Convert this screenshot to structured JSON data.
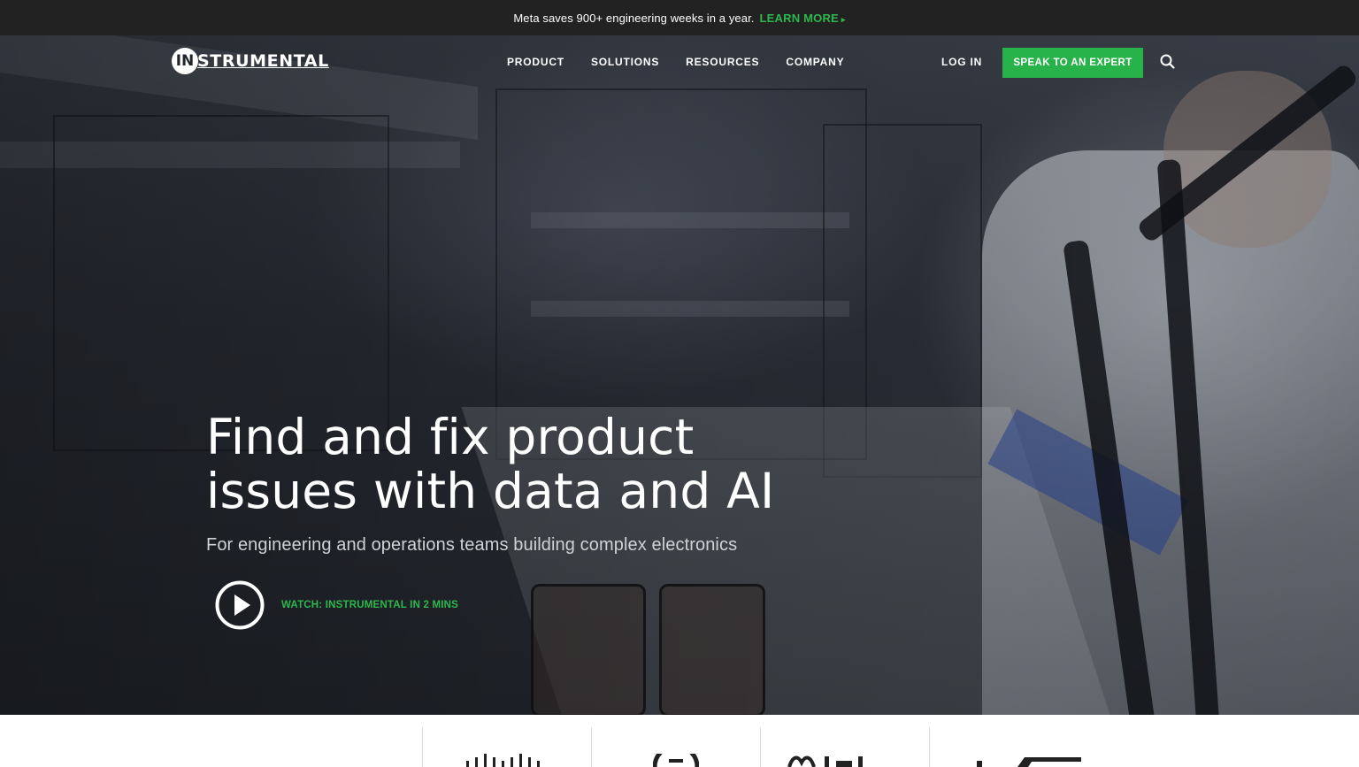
{
  "announcement": {
    "text": "Meta saves 900+ engineering weeks in a year.",
    "link_label": "LEARN MORE",
    "link_icon": "caret-right-icon",
    "accent_color": "#2db84d"
  },
  "brand": {
    "logo_letters": "IN",
    "logo_word": "STRUMENTAL"
  },
  "nav": {
    "items": [
      "PRODUCT",
      "SOLUTIONS",
      "RESOURCES",
      "COMPANY"
    ],
    "login_label": "LOG IN",
    "cta_label": "SPEAK TO AN EXPERT",
    "cta_color": "#27b24a",
    "search_icon": "search-icon"
  },
  "hero": {
    "headline_line1": "Find and fix product",
    "headline_line2": "issues with data and AI",
    "subheadline": "For engineering and operations teams building complex electronics",
    "watch_label": "WATCH: INSTRUMENTAL IN 2 MINS",
    "play_icon": "play-circle-icon"
  },
  "customer_logos": {
    "icons": [
      "cisco-logo-icon",
      "circular-logo-icon",
      "meta-logo-icon",
      "partial-logo-icon"
    ]
  }
}
